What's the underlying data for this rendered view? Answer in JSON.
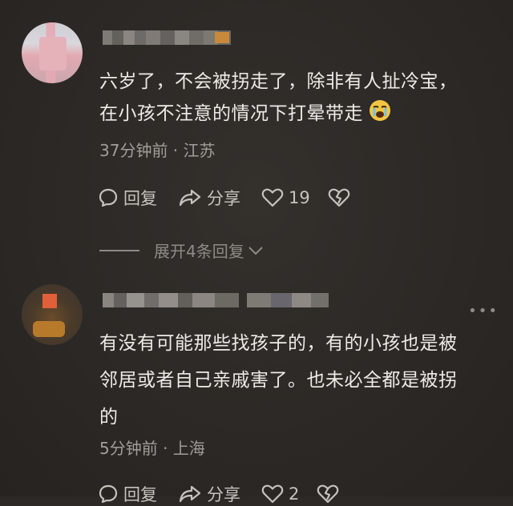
{
  "comments": [
    {
      "text_lines": [
        "六岁了，不会被拐走了，除非有人扯冷宝，",
        "在小孩不注意的情况下打晕带走"
      ],
      "emoji_icon": "crying-face-icon",
      "meta": "37分钟前 · 江苏",
      "reply_label": "回复",
      "share_label": "分享",
      "like_count": "19",
      "expand_label": "展开4条回复"
    },
    {
      "text_lines": [
        "有没有可能那些找孩子的，有的小孩也是被",
        "邻居或者自己亲戚害了。也未必全都是被拐",
        "的"
      ],
      "meta": "5分钟前 · 上海",
      "reply_label": "回复",
      "share_label": "分享",
      "like_count": "2"
    }
  ],
  "icons": {
    "reply": "chat-bubble-icon",
    "share": "share-arrow-icon",
    "like": "heart-icon",
    "dislike": "broken-heart-icon",
    "expand": "chevron-down-icon",
    "more": "more-dots-icon"
  },
  "colors": {
    "background": "#2c2926",
    "text": "#eeeae6",
    "meta": "#a29d98",
    "action": "#c7c2bd"
  }
}
